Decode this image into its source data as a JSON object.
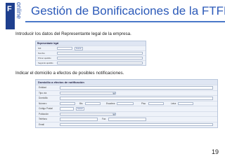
{
  "header": {
    "logo_letter": "F",
    "logo_word": "online",
    "title": "Gestión de Bonificaciones de la FTFE",
    "brand_color": "#2b59b8"
  },
  "section1": {
    "intro": "Introducir los datos del Representante legal de la empresa.",
    "form_title": "Representante legal",
    "rows": [
      "NIF",
      "Nombre",
      "Primer apellido",
      "Segundo apellido"
    ],
    "nif_button": "buscar"
  },
  "section2": {
    "intro": "Indicar el domicilio a efectos de posibles notificaciones.",
    "form_title": "Domicilio a efectos de notificación",
    "rows": [
      "Entidad",
      "Tipo vía",
      "Domicilio",
      "Número",
      "Código Postal",
      "Población",
      "Teléfono",
      "Email"
    ],
    "inline_labels": {
      "bis": "Bis",
      "escalera": "Escalera",
      "piso": "Piso",
      "letra": "Letra",
      "fax": "Fax"
    },
    "cp_button": "buscar"
  },
  "footer": {
    "page_number": "19"
  }
}
